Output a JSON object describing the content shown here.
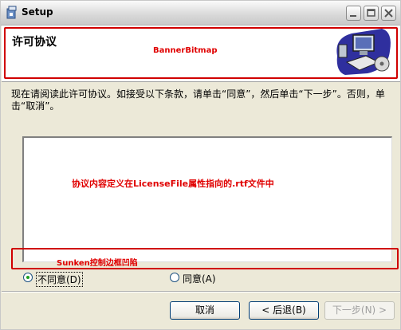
{
  "window": {
    "title": "Setup"
  },
  "banner": {
    "title": "许可协议",
    "bitmap_label": "BannerBitmap",
    "icon": "computer-setup-icon"
  },
  "instruction": "现在请阅读此许可协议。如接受以下条款，请单击“同意”，然后单击“下一步”。否则，单击“取消”。",
  "license": {
    "note": "协议内容定义在LicenseFile属性指向的.rtf文件中",
    "border_note": "Sunken控制边框凹陷"
  },
  "radios": {
    "disagree": {
      "label": "不同意(D)",
      "selected": true
    },
    "agree": {
      "label": "同意(A)",
      "selected": false
    }
  },
  "buttons": {
    "cancel": "取消",
    "back": "< 后退(B)",
    "next": "下一步(N) >"
  },
  "colors": {
    "annotation_red": "#e00000",
    "radio_selected": "#21a121"
  }
}
